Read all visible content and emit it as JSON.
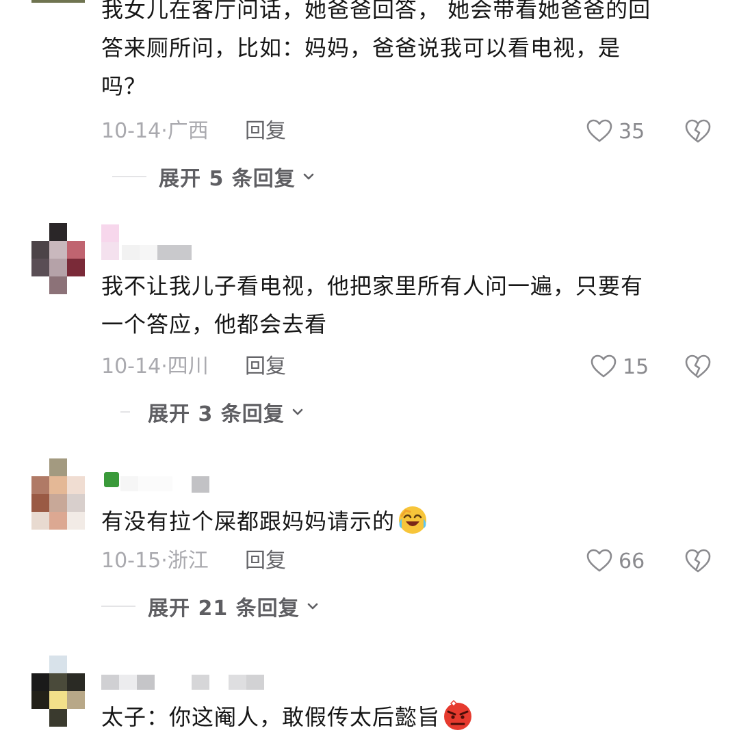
{
  "comments": [
    {
      "text_lines": [
        "我女儿在客厅问话，她爸爸回答， 她会带看她爸爸的回",
        "答来厕所问，比如：妈妈，爸爸说我可以看电视，是",
        "吗？"
      ],
      "date": "10-14",
      "separator": "·",
      "location": "广西",
      "reply_label": "回复",
      "likes": "35",
      "expand_label": "展开 5 条回复"
    },
    {
      "text_lines": [
        "我不让我儿子看电视，他把家里所有人问一遍，只要有",
        "一个答应，他都会去看"
      ],
      "date": "10-14",
      "separator": "·",
      "location": "四川",
      "reply_label": "回复",
      "likes": "15",
      "expand_label": "展开 3 条回复"
    },
    {
      "text_lines": [
        "有没有拉个屎都跟妈妈请示的"
      ],
      "emoji": "laughing-crying-emoji",
      "date": "10-15",
      "separator": "·",
      "location": "浙江",
      "reply_label": "回复",
      "likes": "66",
      "expand_label": "展开 21 条回复"
    },
    {
      "text_lines": [
        "太子：你这阉人，敢假传太后懿旨"
      ],
      "emoji": "angry-face-emoji"
    }
  ],
  "icons": {
    "like": "heart-outline-icon",
    "dislike": "broken-heart-icon",
    "expand": "chevron-down-icon"
  },
  "colors": {
    "text": "#161616",
    "meta": "#a9a9ae",
    "reply": "#646468",
    "icon": "#8a8a8e"
  }
}
